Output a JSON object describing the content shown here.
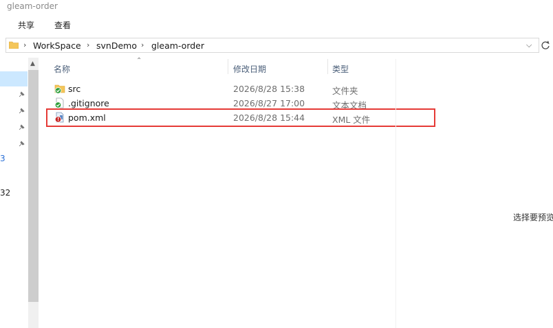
{
  "window": {
    "title": "gleam-order"
  },
  "ribbon": {
    "tabs": [
      "共享",
      "查看"
    ]
  },
  "address": {
    "crumbs": [
      "WorkSpace",
      "svnDemo",
      "gleam-order"
    ]
  },
  "nav": {
    "fragments": [
      "3",
      "32"
    ]
  },
  "columns": {
    "name": "名称",
    "modified": "修改日期",
    "type": "类型"
  },
  "files": [
    {
      "name": "src",
      "modified": "2026/8/28 15:38",
      "type": "文件夹",
      "icon": "folder-svn-ok-icon"
    },
    {
      "name": ".gitignore",
      "modified": "2026/8/27 17:00",
      "type": "文本文档",
      "icon": "file-svn-ok-icon"
    },
    {
      "name": "pom.xml",
      "modified": "2026/8/28 15:44",
      "type": "XML 文件",
      "icon": "file-svn-modified-icon"
    }
  ],
  "preview": {
    "message": "选择要预览"
  },
  "colors": {
    "highlight": "#e53935",
    "svn_ok": "#2e9e3a",
    "svn_modified": "#c62828",
    "nav_selected": "#cce8ff"
  }
}
